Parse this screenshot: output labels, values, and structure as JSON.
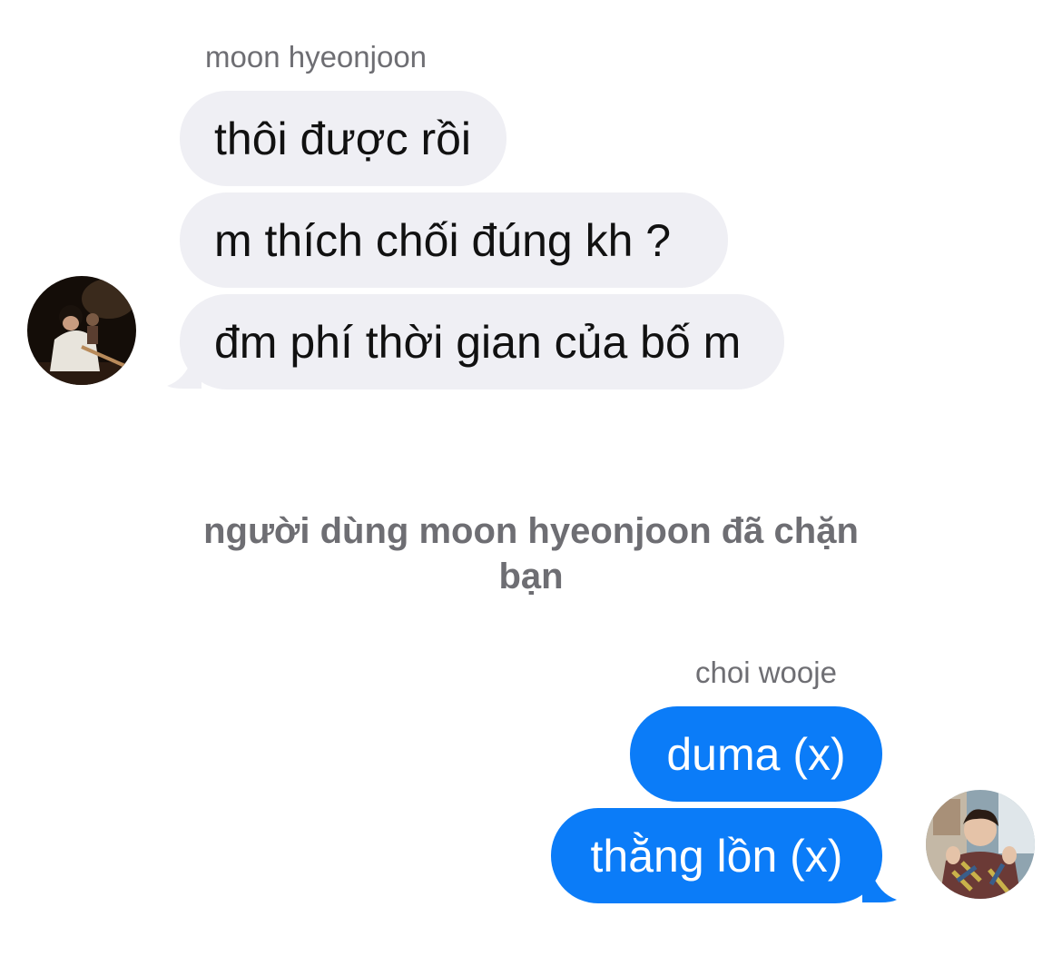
{
  "incoming": {
    "sender_name": "moon hyeonjoon",
    "messages": [
      "thôi được rồi",
      "m thích chối đúng kh ?",
      "đm phí thời gian của bố m"
    ],
    "bubble_color": "#efeff4"
  },
  "system_notice": "người dùng moon hyeonjoon đã chặn bạn",
  "outgoing": {
    "sender_name": "choi wooje",
    "messages": [
      "duma (x)",
      "thằng lồn (x)"
    ],
    "bubble_color": "#0b7cf8"
  }
}
